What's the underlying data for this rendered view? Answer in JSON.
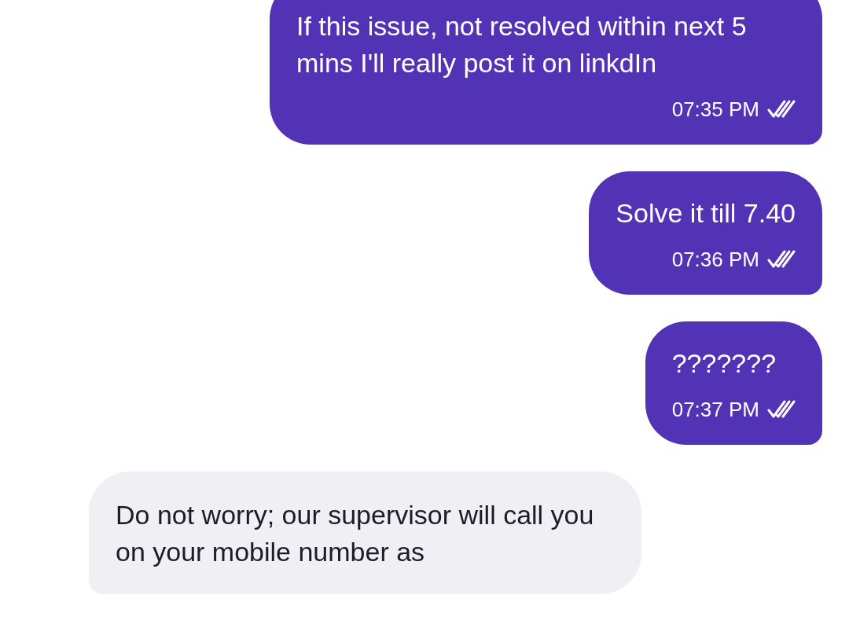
{
  "messages": [
    {
      "kind": "outgoing",
      "text": "If this issue, not resolved within next 5 mins I'll really post it on linkdIn",
      "time": "07:35 PM",
      "read": true
    },
    {
      "kind": "outgoing",
      "text": "Solve it till 7.40",
      "time": "07:36 PM",
      "read": true
    },
    {
      "kind": "outgoing",
      "text": "???????",
      "time": "07:37 PM",
      "read": true
    },
    {
      "kind": "incoming",
      "text": "Do not worry; our supervisor will call you on your mobile number as"
    }
  ]
}
